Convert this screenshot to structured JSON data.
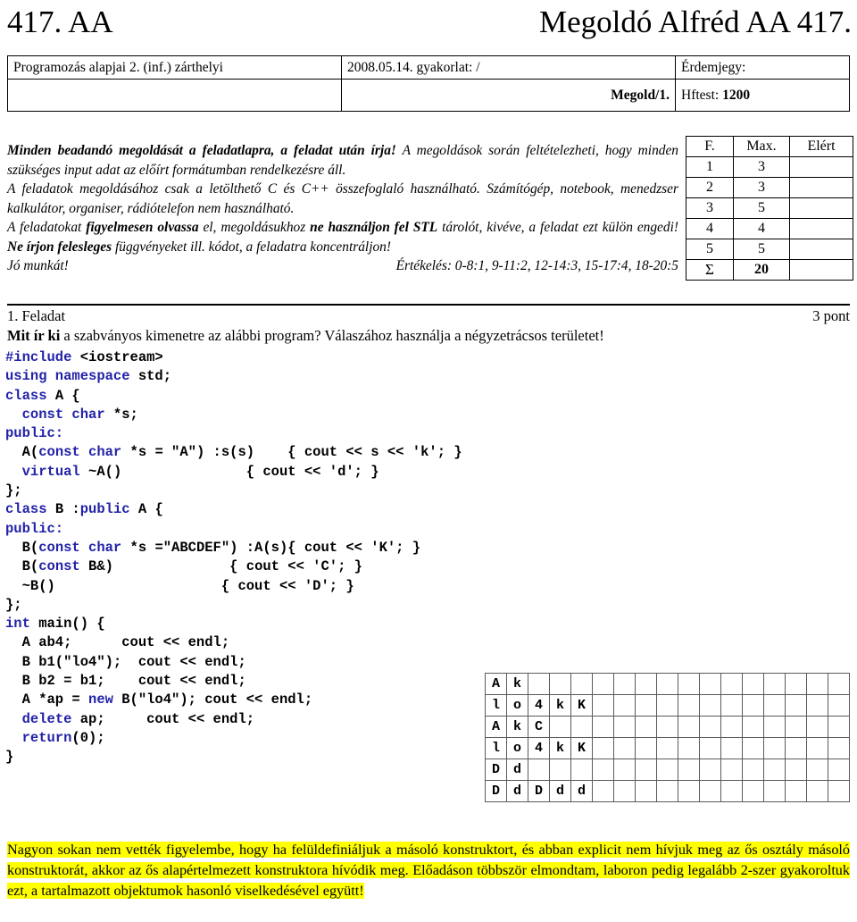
{
  "title": {
    "left": "417. AA",
    "right": "Megoldó Alfréd AA 417."
  },
  "header": {
    "course": "Programozás alapjai 2. (inf.) zárthelyi",
    "date_practice": "2008.05.14. gyakorlat: /",
    "grade_label": "Érdemjegy:",
    "solution_label": "Megold/1.",
    "hftest_label": "Hftest:",
    "hftest_value": "1200"
  },
  "instructions": {
    "line1_bold": "Minden beadandó megoldását a feladatlapra, a feladat után írja!",
    "line1_rest": " A megoldások során feltételezheti, hogy minden szükséges input adat az előírt formátumban rendelkezésre áll.",
    "line2": "A feladatok megoldásához csak a letölthető C és C++ összefoglaló használható. Számítógép, notebook, menedzser kalkulátor, organiser, rádiótelefon nem használható.",
    "line3_a": "A feladatokat ",
    "line3_b": "figyelmesen olvassa",
    "line3_c": " el, megoldásukhoz ",
    "line3_d": "ne használjon fel STL",
    "line3_e": " tárolót, kivéve, a feladat ezt külön engedi! ",
    "line3_f": "Ne írjon felesleges",
    "line3_g": " függvényeket ill. kódot, a feladatra koncentráljon!",
    "good_work": "Jó munkát!",
    "grading": "Értékelés: 0-8:1, 9-11:2, 12-14:3, 15-17:4, 18-20:5"
  },
  "score_table": {
    "headers": [
      "F.",
      "Max.",
      "Elért"
    ],
    "rows": [
      {
        "f": "1",
        "max": "3",
        "elert": ""
      },
      {
        "f": "2",
        "max": "3",
        "elert": ""
      },
      {
        "f": "3",
        "max": "5",
        "elert": ""
      },
      {
        "f": "4",
        "max": "4",
        "elert": ""
      },
      {
        "f": "5",
        "max": "5",
        "elert": ""
      }
    ],
    "sum": {
      "f": "Σ",
      "max": "20",
      "elert": ""
    }
  },
  "task": {
    "number": "1. Feladat",
    "points": "3 pont",
    "question_bold": "Mit ír ki",
    "question_rest": " a szabványos kimenetre az alábbi program? Válaszához használja a négyzetrácsos területet!"
  },
  "code": {
    "lines": [
      [
        {
          "t": "#include",
          "k": true
        },
        {
          "t": " <iostream>",
          "k": false
        }
      ],
      [
        {
          "t": "using namespace",
          "k": true
        },
        {
          "t": " std;",
          "k": false
        }
      ],
      [
        {
          "t": "class",
          "k": true
        },
        {
          "t": " A {",
          "k": false
        }
      ],
      [
        {
          "t": "  ",
          "k": false
        },
        {
          "t": "const char",
          "k": true
        },
        {
          "t": " *s;",
          "k": false
        }
      ],
      [
        {
          "t": "public:",
          "k": true
        }
      ],
      [
        {
          "t": "  A(",
          "k": false
        },
        {
          "t": "const char",
          "k": true
        },
        {
          "t": " *s = ",
          "k": false
        },
        {
          "t": "\"A\"",
          "k": false
        },
        {
          "t": ") :s(s)    { cout << s << 'k'; }",
          "k": false
        }
      ],
      [
        {
          "t": "  ",
          "k": false
        },
        {
          "t": "virtual",
          "k": true
        },
        {
          "t": " ~A()               { cout << 'd'; }",
          "k": false
        }
      ],
      [
        {
          "t": "};",
          "k": false
        }
      ],
      [
        {
          "t": "class",
          "k": true
        },
        {
          "t": " B :",
          "k": false
        },
        {
          "t": "public",
          "k": true
        },
        {
          "t": " A {",
          "k": false
        }
      ],
      [
        {
          "t": "public:",
          "k": true
        }
      ],
      [
        {
          "t": "  B(",
          "k": false
        },
        {
          "t": "const char",
          "k": true
        },
        {
          "t": " *s =\"ABCDEF\") :A(s){ cout << 'K'; }",
          "k": false
        }
      ],
      [
        {
          "t": "  B(",
          "k": false
        },
        {
          "t": "const",
          "k": true
        },
        {
          "t": " B&)              { cout << 'C'; }",
          "k": false
        }
      ],
      [
        {
          "t": "  ~B()                    { cout << 'D'; }",
          "k": false
        }
      ],
      [
        {
          "t": "};",
          "k": false
        }
      ],
      [
        {
          "t": "int",
          "k": true
        },
        {
          "t": " main() {",
          "k": false
        }
      ],
      [
        {
          "t": "  A ab4;      cout << endl;",
          "k": false
        }
      ],
      [
        {
          "t": "  B b1(\"lo4\");  cout << endl;",
          "k": false
        }
      ],
      [
        {
          "t": "  B b2 = b1;    cout << endl;",
          "k": false
        }
      ],
      [
        {
          "t": "  A *ap = ",
          "k": false
        },
        {
          "t": "new",
          "k": true
        },
        {
          "t": " B(\"lo4\"); cout << endl;",
          "k": false
        }
      ],
      [
        {
          "t": "  ",
          "k": false
        },
        {
          "t": "delete",
          "k": true
        },
        {
          "t": " ap;     cout << endl;",
          "k": false
        }
      ],
      [
        {
          "t": "  ",
          "k": false
        },
        {
          "t": "return",
          "k": true
        },
        {
          "t": "(0);",
          "k": false
        }
      ],
      [
        {
          "t": "}",
          "k": false
        }
      ]
    ]
  },
  "answer_grid": {
    "columns": 17,
    "rows": [
      [
        "A",
        "k",
        "",
        "",
        "",
        "",
        "",
        "",
        "",
        "",
        "",
        "",
        "",
        "",
        "",
        "",
        ""
      ],
      [
        "l",
        "o",
        "4",
        "k",
        "K",
        "",
        "",
        "",
        "",
        "",
        "",
        "",
        "",
        "",
        "",
        "",
        ""
      ],
      [
        "A",
        "k",
        "C",
        "",
        "",
        "",
        "",
        "",
        "",
        "",
        "",
        "",
        "",
        "",
        "",
        "",
        ""
      ],
      [
        "l",
        "o",
        "4",
        "k",
        "K",
        "",
        "",
        "",
        "",
        "",
        "",
        "",
        "",
        "",
        "",
        "",
        ""
      ],
      [
        "D",
        "d",
        "",
        "",
        "",
        "",
        "",
        "",
        "",
        "",
        "",
        "",
        "",
        "",
        "",
        "",
        ""
      ],
      [
        "D",
        "d",
        "D",
        "d",
        "d",
        "",
        "",
        "",
        "",
        "",
        "",
        "",
        "",
        "",
        "",
        "",
        ""
      ]
    ]
  },
  "comment": {
    "text": "Nagyon sokan nem vették figyelembe, hogy ha felüldefiniáljuk a másoló konstruktort, és abban explicit nem hívjuk meg az ős osztály másoló konstruktorát, akkor az ős alapértelmezett konstruktora hívódik meg. Előadáson többször elmondtam, laboron pedig legalább 2-szer gyakoroltuk ezt, a tartalmazott objektumok hasonló viselkedésével együtt!",
    "highlight_color": "#ffff00"
  }
}
